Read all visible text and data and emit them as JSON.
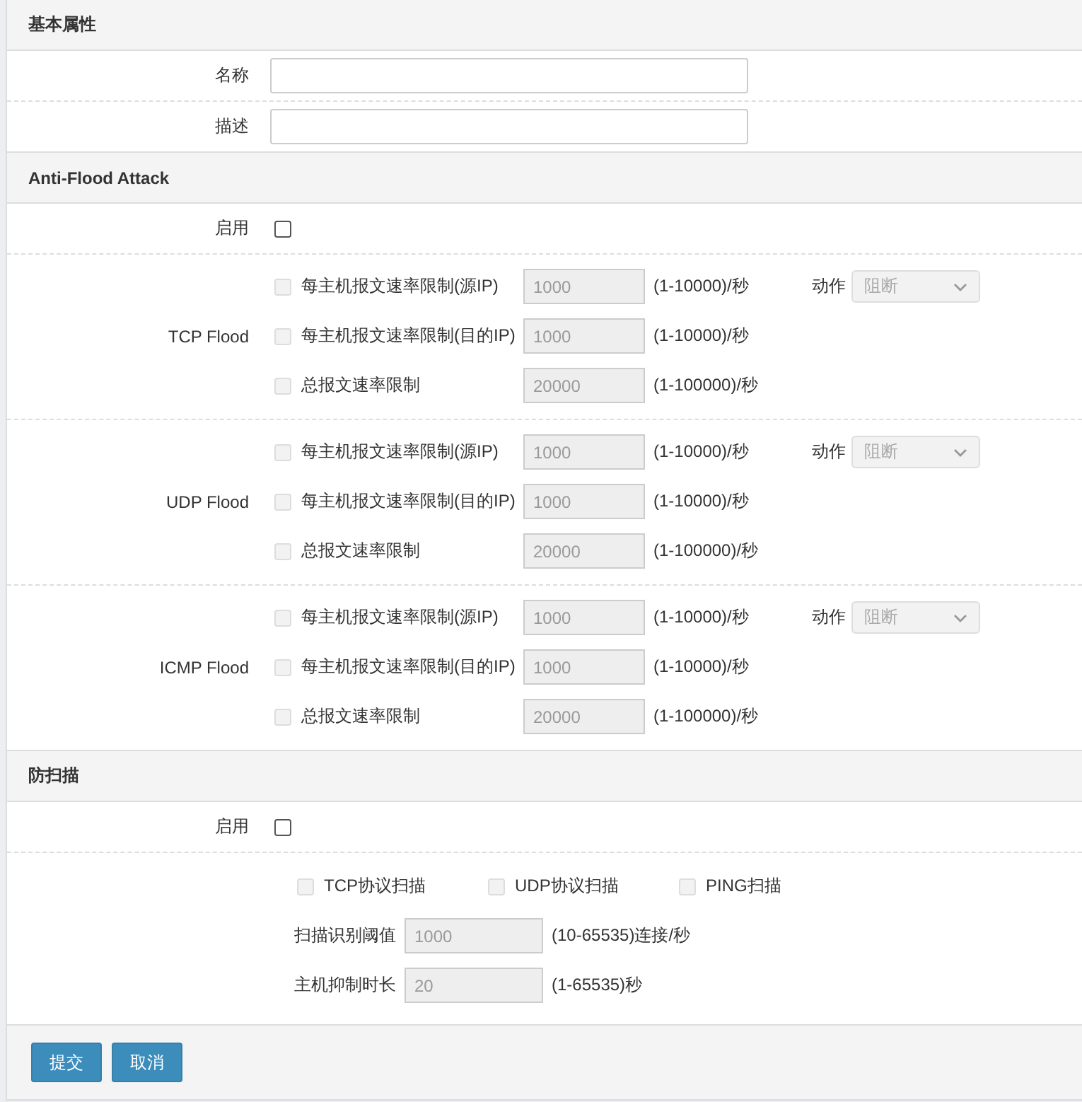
{
  "basic": {
    "title": "基本属性",
    "fields": [
      {
        "label": "名称"
      },
      {
        "label": "描述"
      }
    ]
  },
  "flood": {
    "title": "Anti-Flood Attack",
    "enable": {
      "label": "启用",
      "checked": false
    },
    "groups": [
      {
        "name": "TCP Flood",
        "action": {
          "label": "动作",
          "value": "阻断",
          "disabled": true
        },
        "rows": [
          {
            "label": "每主机报文速率限制(源IP)",
            "checked": false,
            "disabled": true,
            "value": "1000",
            "range": "(1-10000)/秒"
          },
          {
            "label": "每主机报文速率限制(目的IP)",
            "checked": false,
            "disabled": true,
            "value": "1000",
            "range": "(1-10000)/秒"
          },
          {
            "label": "总报文速率限制",
            "checked": false,
            "disabled": true,
            "value": "20000",
            "range": "(1-100000)/秒"
          }
        ]
      },
      {
        "name": "UDP Flood",
        "action": {
          "label": "动作",
          "value": "阻断",
          "disabled": true
        },
        "rows": [
          {
            "label": "每主机报文速率限制(源IP)",
            "checked": false,
            "disabled": true,
            "value": "1000",
            "range": "(1-10000)/秒"
          },
          {
            "label": "每主机报文速率限制(目的IP)",
            "checked": false,
            "disabled": true,
            "value": "1000",
            "range": "(1-10000)/秒"
          },
          {
            "label": "总报文速率限制",
            "checked": false,
            "disabled": true,
            "value": "20000",
            "range": "(1-100000)/秒"
          }
        ]
      },
      {
        "name": "ICMP Flood",
        "action": {
          "label": "动作",
          "value": "阻断",
          "disabled": true
        },
        "rows": [
          {
            "label": "每主机报文速率限制(源IP)",
            "checked": false,
            "disabled": true,
            "value": "1000",
            "range": "(1-10000)/秒"
          },
          {
            "label": "每主机报文速率限制(目的IP)",
            "checked": false,
            "disabled": true,
            "value": "1000",
            "range": "(1-10000)/秒"
          },
          {
            "label": "总报文速率限制",
            "checked": false,
            "disabled": true,
            "value": "20000",
            "range": "(1-100000)/秒"
          }
        ]
      }
    ]
  },
  "scan": {
    "title": "防扫描",
    "enable": {
      "label": "启用",
      "checked": false
    },
    "options": [
      {
        "label": "TCP协议扫描",
        "checked": false,
        "disabled": true
      },
      {
        "label": "UDP协议扫描",
        "checked": false,
        "disabled": true
      },
      {
        "label": "PING扫描",
        "checked": false,
        "disabled": true
      }
    ],
    "params": [
      {
        "label": "扫描识别阈值",
        "value": "1000",
        "disabled": true,
        "range": "(10-65535)连接/秒"
      },
      {
        "label": "主机抑制时长",
        "value": "20",
        "disabled": true,
        "range": "(1-65535)秒"
      }
    ]
  },
  "buttons": [
    {
      "label": "提交"
    },
    {
      "label": "取消"
    }
  ]
}
